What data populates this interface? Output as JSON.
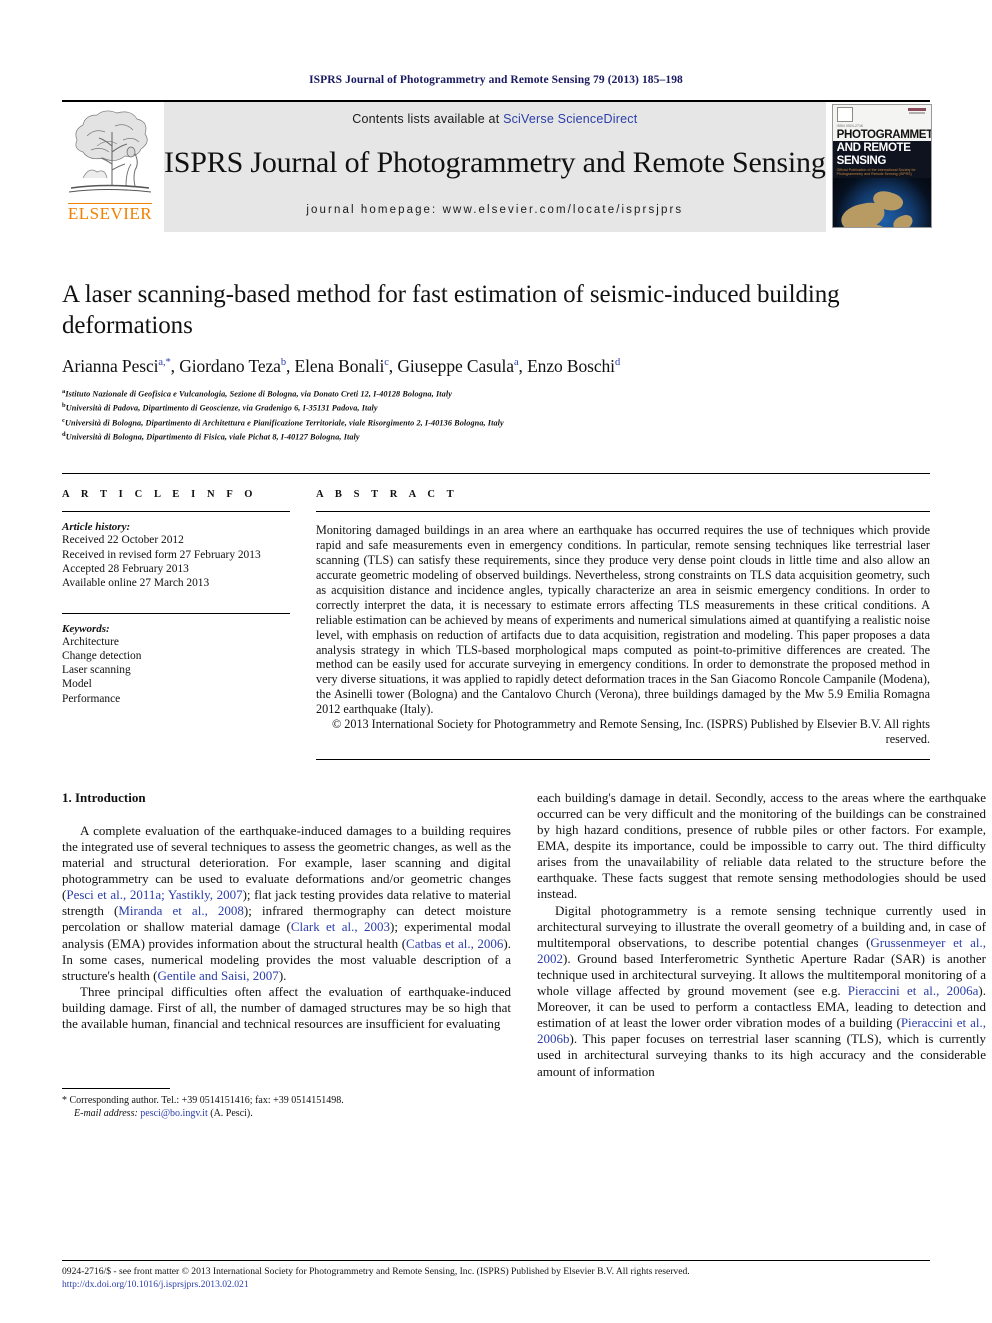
{
  "running_head": "ISPRS Journal of Photogrammetry and Remote Sensing 79 (2013) 185–198",
  "masthead": {
    "contents_prefix": "Contents lists available at ",
    "sciencedirect_link": "SciVerse ScienceDirect",
    "journal_title": "ISPRS Journal of Photogrammetry and Remote Sensing",
    "homepage": "journal homepage: www.elsevier.com/locate/isprsjprs",
    "publisher_logo_text": "ELSEVIER",
    "cover": {
      "issn_tag": "ISSN 0924-2716",
      "title_line1": "PHOTOGRAMMETRY",
      "title_line2": "AND REMOTE SENSING",
      "subtitle": "Official Publication of the International Society for Photogrammetry and Remote Sensing (ISPRS)"
    }
  },
  "article": {
    "title": "A laser scanning-based method for fast estimation of seismic-induced building deformations",
    "authors": [
      {
        "name": "Arianna Pesci",
        "marks": "a,*"
      },
      {
        "name": "Giordano Teza",
        "marks": "b"
      },
      {
        "name": "Elena Bonali",
        "marks": "c"
      },
      {
        "name": "Giuseppe Casula",
        "marks": "a"
      },
      {
        "name": "Enzo Boschi",
        "marks": "d"
      }
    ],
    "affiliations": [
      {
        "mark": "a",
        "text": "Istituto Nazionale di Geofisica e Vulcanologia, Sezione di Bologna, via Donato Creti 12, I-40128 Bologna, Italy"
      },
      {
        "mark": "b",
        "text": "Università di Padova, Dipartimento di Geoscienze, via Gradenigo 6, I-35131 Padova, Italy"
      },
      {
        "mark": "c",
        "text": "Università di Bologna, Dipartimento di Architettura e Pianificazione Territoriale, viale Risorgimento 2, I-40136 Bologna, Italy"
      },
      {
        "mark": "d",
        "text": "Università di Bologna, Dipartimento di Fisica, viale Pichat 8, I-40127 Bologna, Italy"
      }
    ]
  },
  "article_info": {
    "heading": "A R T I C L E   I N F O",
    "history_label": "Article history:",
    "history": [
      "Received 22 October 2012",
      "Received in revised form 27 February 2013",
      "Accepted 28 February 2013",
      "Available online 27 March 2013"
    ],
    "keywords_label": "Keywords:",
    "keywords": [
      "Architecture",
      "Change detection",
      "Laser scanning",
      "Model",
      "Performance"
    ]
  },
  "abstract": {
    "heading": "A B S T R A C T",
    "body": "Monitoring damaged buildings in an area where an earthquake has occurred requires the use of techniques which provide rapid and safe measurements even in emergency conditions. In particular, remote sensing techniques like terrestrial laser scanning (TLS) can satisfy these requirements, since they produce very dense point clouds in little time and also allow an accurate geometric modeling of observed buildings. Nevertheless, strong constraints on TLS data acquisition geometry, such as acquisition distance and incidence angles, typically characterize an area in seismic emergency conditions. In order to correctly interpret the data, it is necessary to estimate errors affecting TLS measurements in these critical conditions. A reliable estimation can be achieved by means of experiments and numerical simulations aimed at quantifying a realistic noise level, with emphasis on reduction of artifacts due to data acquisition, registration and modeling. This paper proposes a data analysis strategy in which TLS-based morphological maps computed as point-to-primitive differences are created. The method can be easily used for accurate surveying in emergency conditions. In order to demonstrate the proposed method in very diverse situations, it was applied to rapidly detect deformation traces in the San Giacomo Roncole Campanile (Modena), the Asinelli tower (Bologna) and the Cantalovo Church (Verona), three buildings damaged by the Mw 5.9 Emilia Romagna 2012 earthquake (Italy).",
    "copyright": "© 2013 International Society for Photogrammetry and Remote Sensing, Inc. (ISPRS) Published by Elsevier B.V. All rights reserved."
  },
  "introduction": {
    "heading": "1. Introduction",
    "left_paragraphs": [
      {
        "segments": [
          {
            "t": "A complete evaluation of the earthquake-induced damages to a building requires the integrated use of several techniques to assess the geometric changes, as well as the material and structural deterioration. For example, laser scanning and digital photogrammetry can be used to evaluate deformations and/or geometric changes ("
          },
          {
            "t": "Pesci et al., 2011a; Yastikly, 2007",
            "ref": true
          },
          {
            "t": "); flat jack testing provides data relative to material strength ("
          },
          {
            "t": "Miranda et al., 2008",
            "ref": true
          },
          {
            "t": "); infrared thermography can detect moisture percolation or shallow material damage ("
          },
          {
            "t": "Clark et al., 2003",
            "ref": true
          },
          {
            "t": "); experimental modal analysis (EMA) provides information about the structural health ("
          },
          {
            "t": "Catbas et al., 2006",
            "ref": true
          },
          {
            "t": "). In some cases, numerical modeling provides the most valuable description of a structure's health ("
          },
          {
            "t": "Gentile and Saisi, 2007",
            "ref": true
          },
          {
            "t": ")."
          }
        ]
      },
      {
        "segments": [
          {
            "t": "Three principal difficulties often affect the evaluation of earthquake-induced building damage. First of all, the number of damaged structures may be so high that the available human, financial and technical resources are insufficient for evaluating"
          }
        ]
      }
    ],
    "right_paragraphs": [
      {
        "no_indent": true,
        "segments": [
          {
            "t": "each building's damage in detail. Secondly, access to the areas where the earthquake occurred can be very difficult and the monitoring of the buildings can be constrained by high hazard conditions, presence of rubble piles or other factors. For example, EMA, despite its importance, could be impossible to carry out. The third difficulty arises from the unavailability of reliable data related to the structure before the earthquake. These facts suggest that remote sensing methodologies should be used instead."
          }
        ]
      },
      {
        "segments": [
          {
            "t": "Digital photogrammetry is a remote sensing technique currently used in architectural surveying to illustrate the overall geometry of a building and, in case of multitemporal observations, to describe potential changes ("
          },
          {
            "t": "Grussenmeyer et al., 2002",
            "ref": true
          },
          {
            "t": "). Ground based Interferometric Synthetic Aperture Radar (SAR) is another technique used in architectural surveying. It allows the multitemporal monitoring of a whole village affected by ground movement (see e.g. "
          },
          {
            "t": "Pieraccini et al., 2006a",
            "ref": true
          },
          {
            "t": "). Moreover, it can be used to perform a contactless EMA, leading to detection and estimation of at least the lower order vibration modes of a building ("
          },
          {
            "t": "Pieraccini et al., 2006b",
            "ref": true
          },
          {
            "t": "). This paper focuses on terrestrial laser scanning (TLS), which is currently used in architectural surveying thanks to its high accuracy and the considerable amount of information"
          }
        ]
      }
    ]
  },
  "footnote": {
    "corresponding": "* Corresponding author. Tel.: +39 0514151416; fax: +39 0514151498.",
    "email_label": "E-mail address:",
    "email": "pesci@bo.ingv.it",
    "email_suffix": "(A. Pesci)."
  },
  "page_footer": {
    "line1": "0924-2716/$ - see front matter © 2013 International Society for Photogrammetry and Remote Sensing, Inc. (ISPRS) Published by Elsevier B.V. All rights reserved.",
    "doi": "http://dx.doi.org/10.1016/j.isprsjprs.2013.02.021"
  },
  "colors": {
    "link": "#2b3ea8",
    "running_head": "#1a1a60",
    "elsevier_orange": "#f08000"
  }
}
